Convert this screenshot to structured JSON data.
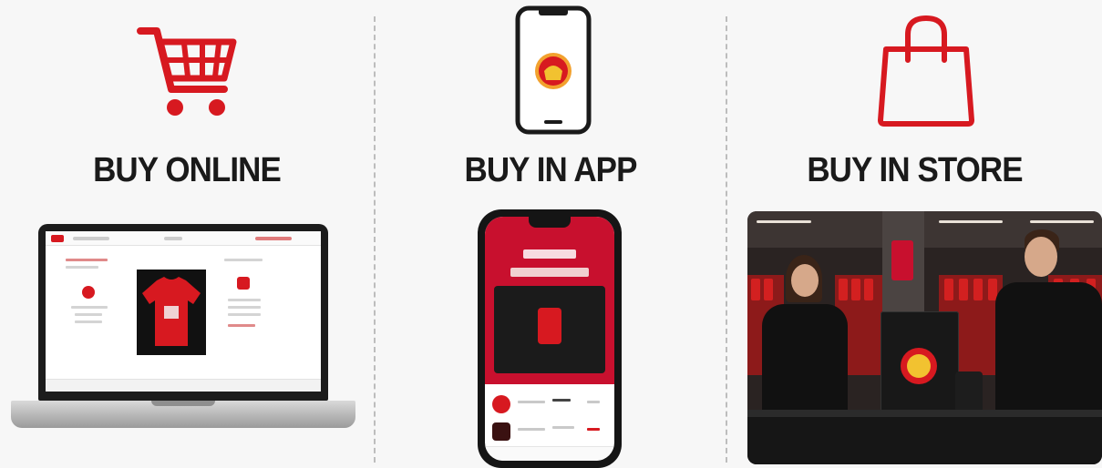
{
  "colors": {
    "accent": "#d71920",
    "text": "#1a1a1a",
    "divider": "#bdbdbd"
  },
  "channels": [
    {
      "title": "BUY ONLINE",
      "icon": "shopping-cart-icon",
      "device": "laptop"
    },
    {
      "title": "BUY IN APP",
      "icon": "smartphone-icon",
      "device": "phone"
    },
    {
      "title": "BUY IN STORE",
      "icon": "shopping-bag-icon",
      "device": "store-photo"
    }
  ]
}
